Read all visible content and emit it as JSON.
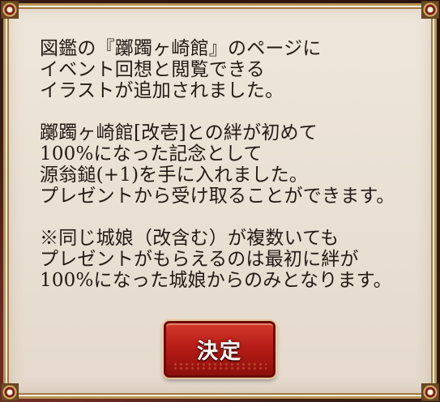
{
  "dialog": {
    "paragraphs": [
      [
        "図鑑の『躑躅ヶ崎館』のページに",
        "イベント回想と閲覧できる",
        "イラストが追加されました。"
      ],
      [
        "躑躅ヶ崎館[改壱]との絆が初めて",
        "100%になった記念として",
        "源翁鎚(+1)を手に入れました。",
        "プレゼントから受け取ることができます。"
      ],
      [
        "※同じ城娘（改含む）が複数いても",
        "プレゼントがもらえるのは最初に絆が",
        "100%になった城娘からのみとなります。"
      ]
    ],
    "ok_label": "決定"
  }
}
